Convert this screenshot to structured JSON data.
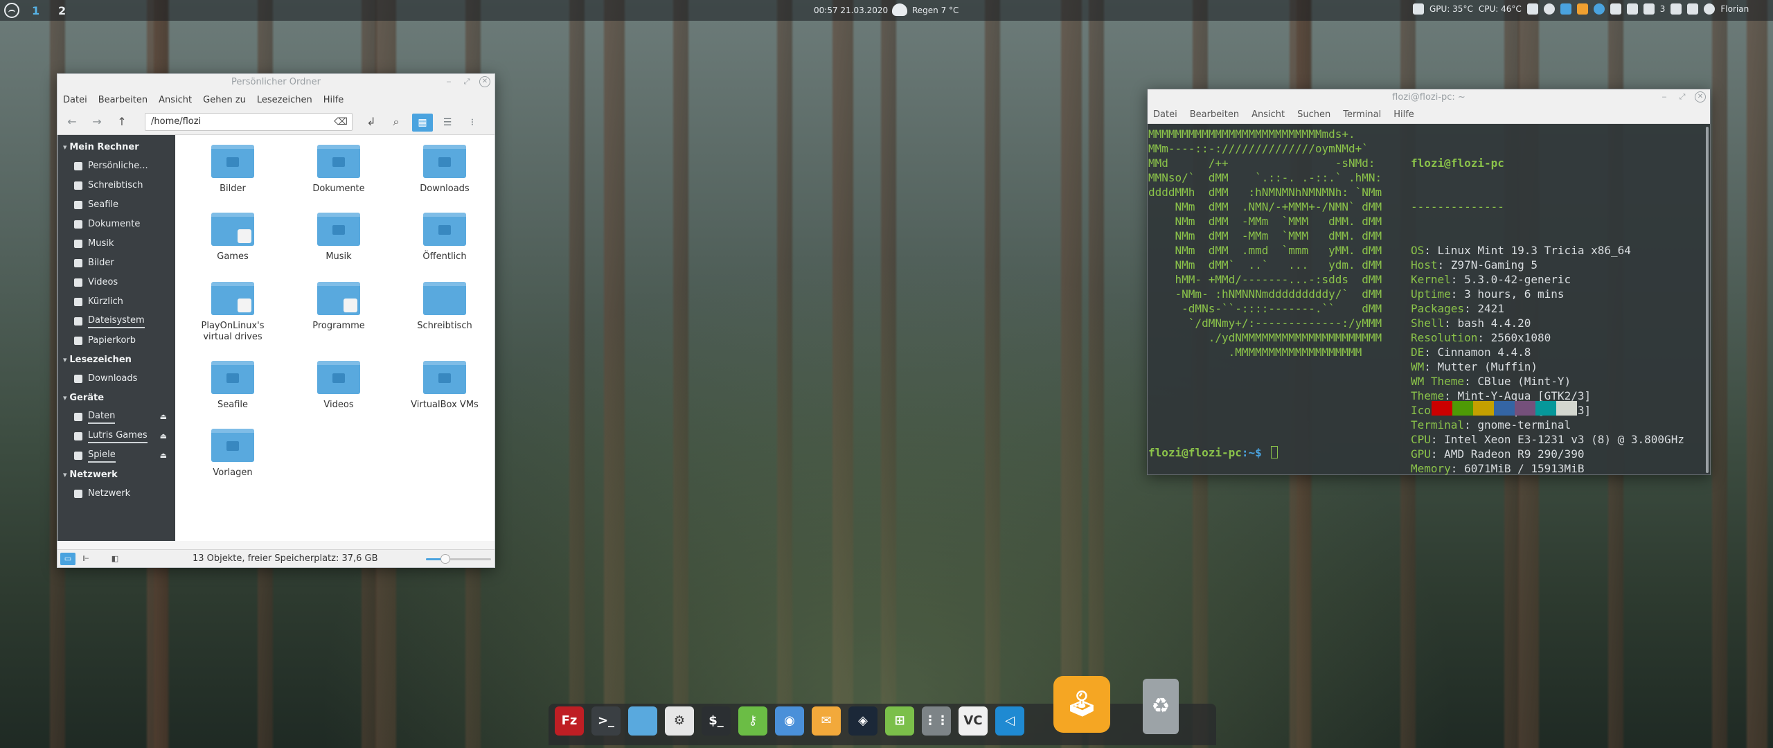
{
  "panel": {
    "workspaces": [
      "1",
      "2"
    ],
    "clock": "00:57  21.03.2020",
    "weather": "Regen 7 °C",
    "gpu_temp": "GPU: 35°C",
    "cpu_temp": "CPU: 46°C",
    "notification_count": "3",
    "user": "Florian"
  },
  "filemanager": {
    "title": "Persönlicher Ordner",
    "menu": [
      "Datei",
      "Bearbeiten",
      "Ansicht",
      "Gehen zu",
      "Lesezeichen",
      "Hilfe"
    ],
    "location": "/home/flozi",
    "sidebar": {
      "sections": [
        {
          "heading": "Mein Rechner",
          "items": [
            "Persönliche...",
            "Schreibtisch",
            "Seafile",
            "Dokumente",
            "Musik",
            "Bilder",
            "Videos",
            "Kürzlich",
            "Dateisystem",
            "Papierkorb"
          ]
        },
        {
          "heading": "Lesezeichen",
          "items": [
            "Downloads"
          ]
        },
        {
          "heading": "Geräte",
          "items": [
            "Daten",
            "Lutris Games",
            "Spiele"
          ]
        },
        {
          "heading": "Netzwerk",
          "items": [
            "Netzwerk"
          ]
        }
      ]
    },
    "files": [
      "Bilder",
      "Dokumente",
      "Downloads",
      "Games",
      "Musik",
      "Öffentlich",
      "PlayOnLinux's virtual drives",
      "Programme",
      "Schreibtisch",
      "Seafile",
      "Videos",
      "VirtualBox VMs",
      "Vorlagen"
    ],
    "status": "13 Objekte, freier Speicherplatz: 37,6 GB",
    "zoom_fraction": 0.3,
    "accent": "#4aa3df"
  },
  "terminal": {
    "title": "flozi@flozi-pc: ~",
    "menu": [
      "Datei",
      "Bearbeiten",
      "Ansicht",
      "Suchen",
      "Terminal",
      "Hilfe"
    ],
    "logo": "MMMMMMMMMMMMMMMMMMMMMMMMMMmds+.\nMMm----::-://////////////oymNMd+`\nMMd      /++                -sNMd:\nMMNso/`  dMM    `.::-. .-::.` .hMN:\nddddMMh  dMM   :hNMNMNhNMNMNh: `NMm\n    NMm  dMM  .NMN/-+MMM+-/NMN` dMM\n    NMm  dMM  -MMm  `MMM   dMM. dMM\n    NMm  dMM  -MMm  `MMM   dMM. dMM\n    NMm  dMM  .mmd  `mmm   yMM. dMM\n    NMm  dMM`  ..`   ...   ydm. dMM\n    hMM- +MMd/-------...-:sdds  dMM\n    -NMm- :hNMNNNmdddddddddy/`  dMM\n     -dMNs-``-::::-------.``    dMM\n      `/dMNmy+/:-------------:/yMMM\n         ./ydNMMMMMMMMMMMMMMMMMMMMM\n            .MMMMMMMMMMMMMMMMMMM",
    "user_host": "flozi@flozi-pc",
    "separator": "--------------",
    "info": [
      {
        "key": "OS",
        "value": "Linux Mint 19.3 Tricia x86_64"
      },
      {
        "key": "Host",
        "value": "Z97N-Gaming 5"
      },
      {
        "key": "Kernel",
        "value": "5.3.0-42-generic"
      },
      {
        "key": "Uptime",
        "value": "3 hours, 6 mins"
      },
      {
        "key": "Packages",
        "value": "2421"
      },
      {
        "key": "Shell",
        "value": "bash 4.4.20"
      },
      {
        "key": "Resolution",
        "value": "2560x1080"
      },
      {
        "key": "DE",
        "value": "Cinnamon 4.4.8"
      },
      {
        "key": "WM",
        "value": "Mutter (Muffin)"
      },
      {
        "key": "WM Theme",
        "value": "CBlue (Mint-Y)"
      },
      {
        "key": "Theme",
        "value": "Mint-Y-Aqua [GTK2/3]"
      },
      {
        "key": "Icons",
        "value": "Mint-Y-Aqua [GTK2/3]"
      },
      {
        "key": "Terminal",
        "value": "gnome-terminal"
      },
      {
        "key": "CPU",
        "value": "Intel Xeon E3-1231 v3 (8) @ 3.800GHz"
      },
      {
        "key": "GPU",
        "value": "AMD Radeon R9 290/390"
      },
      {
        "key": "Memory",
        "value": "6071MiB / 15913MiB"
      }
    ],
    "palette": [
      "#cc0000",
      "#4e9a06",
      "#c4a000",
      "#3465a4",
      "#75507b",
      "#06989a",
      "#d3d7cf"
    ],
    "prompt_user": "flozi@flozi-pc",
    "prompt_path": ":~$"
  },
  "dock": [
    {
      "name": "filezilla-icon",
      "glyph": "Fz",
      "color": "#bf1e24"
    },
    {
      "name": "terminal-icon",
      "glyph": ">_",
      "color": "#3a3f43"
    },
    {
      "name": "files-icon",
      "glyph": "",
      "color": "#59a9de"
    },
    {
      "name": "settings-icon",
      "glyph": "⚙",
      "color": "#e6e6e6"
    },
    {
      "name": "terminal-alt-icon",
      "glyph": "$_",
      "color": "#2b2f32"
    },
    {
      "name": "keepass-icon",
      "glyph": "⚷",
      "color": "#6bbd45"
    },
    {
      "name": "chromium-icon",
      "glyph": "◉",
      "color": "#4a90d9"
    },
    {
      "name": "mail-icon",
      "glyph": "✉",
      "color": "#f2a93b"
    },
    {
      "name": "steam-icon",
      "glyph": "◈",
      "color": "#1b2838"
    },
    {
      "name": "spreadsheet-icon",
      "glyph": "⊞",
      "color": "#7bbf4a"
    },
    {
      "name": "apps-grid-icon",
      "glyph": "⋮⋮",
      "color": "#7d8487"
    },
    {
      "name": "vectorcam-icon",
      "glyph": "VC",
      "color": "#f0f0f0"
    },
    {
      "name": "vscode-icon",
      "glyph": "◁",
      "color": "#1f8ad2"
    },
    {
      "name": "game-joystick-icon",
      "glyph": "🕹",
      "color": "#f5a623"
    },
    {
      "name": "trash-icon",
      "glyph": "♻",
      "color": "#9ca3a7"
    }
  ]
}
